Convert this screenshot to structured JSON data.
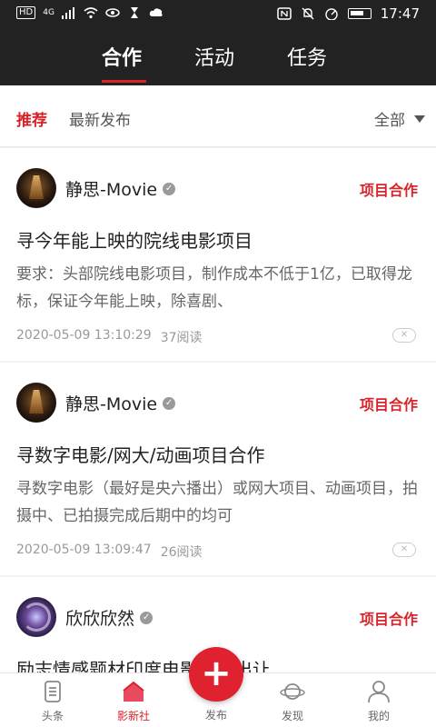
{
  "status_bar": {
    "left_badges": [
      "HD",
      "4G"
    ],
    "time": "17:47"
  },
  "top_tabs": [
    {
      "label": "合作",
      "active": true
    },
    {
      "label": "活动",
      "active": false
    },
    {
      "label": "任务",
      "active": false
    }
  ],
  "filter": {
    "items": [
      {
        "label": "推荐",
        "active": true
      },
      {
        "label": "最新发布",
        "active": false
      }
    ],
    "dropdown_label": "全部"
  },
  "cards": [
    {
      "author": "静思-Movie",
      "verified_icon": "v-badge-icon",
      "tag": "项目合作",
      "title": "寻今年能上映的院线电影项目",
      "desc": "要求：头部院线电影项目，制作成本不低于1亿，已取得龙标，保证今年能上映，除喜剧、",
      "date": "2020-05-09 13:10:29",
      "reads": "37阅读"
    },
    {
      "author": "静思-Movie",
      "verified_icon": "v-badge-icon",
      "tag": "项目合作",
      "title": "寻数字电影/网大/动画项目合作",
      "desc": "寻数字电影（最好是央六播出）或网大项目、动画项目，拍摄中、已拍摄完成后期中的均可",
      "date": "2020-05-09 13:09:47",
      "reads": "26阅读"
    },
    {
      "author": "欣欣欣然",
      "verified_icon": "v-badge-icon",
      "tag": "项目合作",
      "title": "励志情感题材印度电影份额出让"
    }
  ],
  "bottom_nav": [
    {
      "label": "头条",
      "icon": "document-icon",
      "active": false
    },
    {
      "label": "影新社",
      "icon": "house-icon",
      "active": true
    },
    {
      "label": "发布",
      "icon": "plus-icon",
      "active": false
    },
    {
      "label": "发现",
      "icon": "planet-icon",
      "active": false
    },
    {
      "label": "我的",
      "icon": "user-icon",
      "active": false
    }
  ],
  "colors": {
    "accent": "#d8232a",
    "header_bg": "#222222"
  }
}
